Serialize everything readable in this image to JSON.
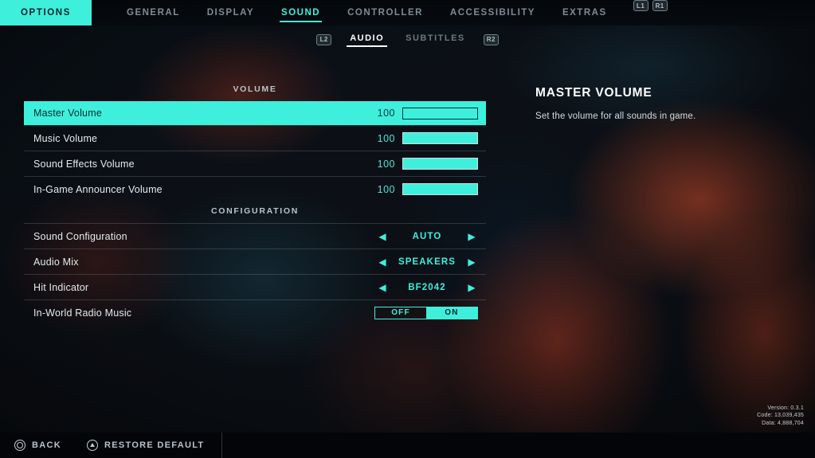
{
  "topnav": {
    "options_label": "OPTIONS",
    "tabs": [
      {
        "label": "GENERAL",
        "active": false
      },
      {
        "label": "DISPLAY",
        "active": false
      },
      {
        "label": "SOUND",
        "active": true
      },
      {
        "label": "CONTROLLER",
        "active": false
      },
      {
        "label": "ACCESSIBILITY",
        "active": false
      },
      {
        "label": "EXTRAS",
        "active": false
      }
    ],
    "shoulder_left": "L1",
    "shoulder_right": "R1"
  },
  "subtabs": {
    "trigger_left": "L2",
    "trigger_right": "R2",
    "tabs": [
      {
        "label": "AUDIO",
        "active": true
      },
      {
        "label": "SUBTITLES",
        "active": false
      }
    ]
  },
  "sections": [
    {
      "header": "VOLUME",
      "rows": [
        {
          "label": "Master Volume",
          "type": "slider",
          "value": "100",
          "percent": 100,
          "selected": true
        },
        {
          "label": "Music Volume",
          "type": "slider",
          "value": "100",
          "percent": 100,
          "selected": false
        },
        {
          "label": "Sound Effects Volume",
          "type": "slider",
          "value": "100",
          "percent": 100,
          "selected": false
        },
        {
          "label": "In-Game Announcer Volume",
          "type": "slider",
          "value": "100",
          "percent": 100,
          "selected": false
        }
      ]
    },
    {
      "header": "CONFIGURATION",
      "rows": [
        {
          "label": "Sound Configuration",
          "type": "selector",
          "value": "AUTO",
          "selected": false
        },
        {
          "label": "Audio Mix",
          "type": "selector",
          "value": "SPEAKERS",
          "selected": false
        },
        {
          "label": "Hit Indicator",
          "type": "selector",
          "value": "BF2042",
          "selected": false
        },
        {
          "label": "In-World Radio Music",
          "type": "toggle",
          "off_label": "OFF",
          "on_label": "ON",
          "value": "ON",
          "selected": false
        }
      ]
    }
  ],
  "description": {
    "title": "MASTER VOLUME",
    "body": "Set the volume for all sounds in game."
  },
  "version": {
    "line1": "Version: 0.3.1",
    "line2": "Code: 13,039,435",
    "line3": "Data: 4,888,704"
  },
  "bottombar": {
    "back_label": "BACK",
    "restore_label": "RESTORE DEFAULT"
  },
  "colors": {
    "accent": "#3ef0dc",
    "accent_dark_text": "#07222a",
    "text_primary": "#e8eef2",
    "text_dim": "#7d8c95"
  }
}
